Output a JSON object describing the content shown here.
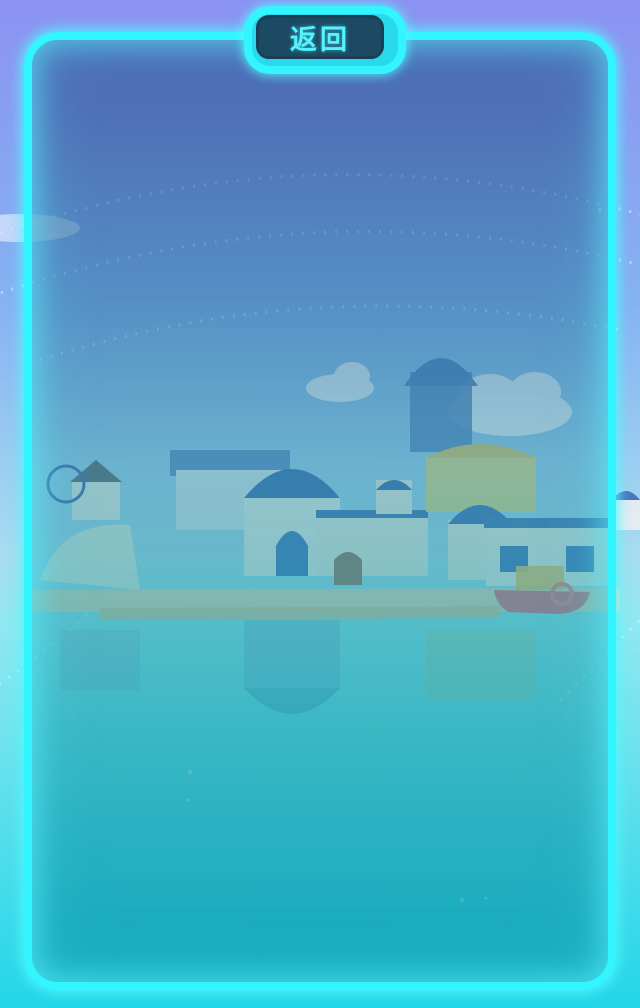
{
  "header": {
    "back_label": "返回"
  },
  "colors": {
    "frame_neon": "#33f5ff",
    "button_bg": "#1b4a62",
    "button_text": "#53f3ff",
    "sky_top": "#8aa6f0",
    "sea": "#2fd4e4"
  },
  "scene": {
    "description_icon": "seaside-town-background"
  }
}
